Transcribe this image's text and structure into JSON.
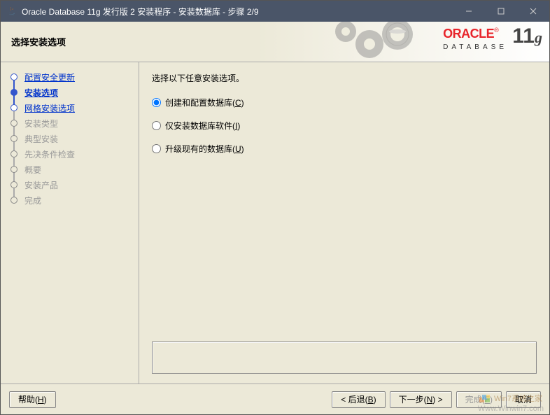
{
  "title": "Oracle Database 11g 发行版 2 安装程序 - 安装数据库 - 步骤 2/9",
  "header": {
    "page_title": "选择安装选项",
    "brand": "ORACLE",
    "subbrand": "DATABASE",
    "version": "11g"
  },
  "sidebar": {
    "steps": [
      {
        "label": "配置安全更新",
        "state": "completed",
        "link": true
      },
      {
        "label": "安装选项",
        "state": "current",
        "link": true
      },
      {
        "label": "网格安装选项",
        "state": "next-active",
        "link": true
      },
      {
        "label": "安装类型",
        "state": "pending",
        "link": false
      },
      {
        "label": "典型安装",
        "state": "pending",
        "link": false
      },
      {
        "label": "先决条件检查",
        "state": "pending",
        "link": false
      },
      {
        "label": "概要",
        "state": "pending",
        "link": false
      },
      {
        "label": "安装产品",
        "state": "pending",
        "link": false
      },
      {
        "label": "完成",
        "state": "pending",
        "link": false
      }
    ]
  },
  "main": {
    "instruction": "选择以下任意安装选项。",
    "options": [
      {
        "label": "创建和配置数据库(",
        "accel": "C",
        "suffix": ")",
        "checked": true
      },
      {
        "label": "仅安装数据库软件(",
        "accel": "I",
        "suffix": ")",
        "checked": false
      },
      {
        "label": "升级现有的数据库(",
        "accel": "U",
        "suffix": ")",
        "checked": false
      }
    ]
  },
  "footer": {
    "help": {
      "label": "帮助(",
      "accel": "H",
      "suffix": ")"
    },
    "back": {
      "label": "< 后退(",
      "accel": "B",
      "suffix": ")"
    },
    "next": {
      "label": "下一步(",
      "accel": "N",
      "suffix": ") >"
    },
    "finish": {
      "label": "完成(",
      "accel": "F",
      "suffix": ")"
    },
    "cancel": {
      "label": "取消"
    }
  },
  "watermark": {
    "brand": "Win7系统之家",
    "url": "Www.Winwin7.com"
  }
}
